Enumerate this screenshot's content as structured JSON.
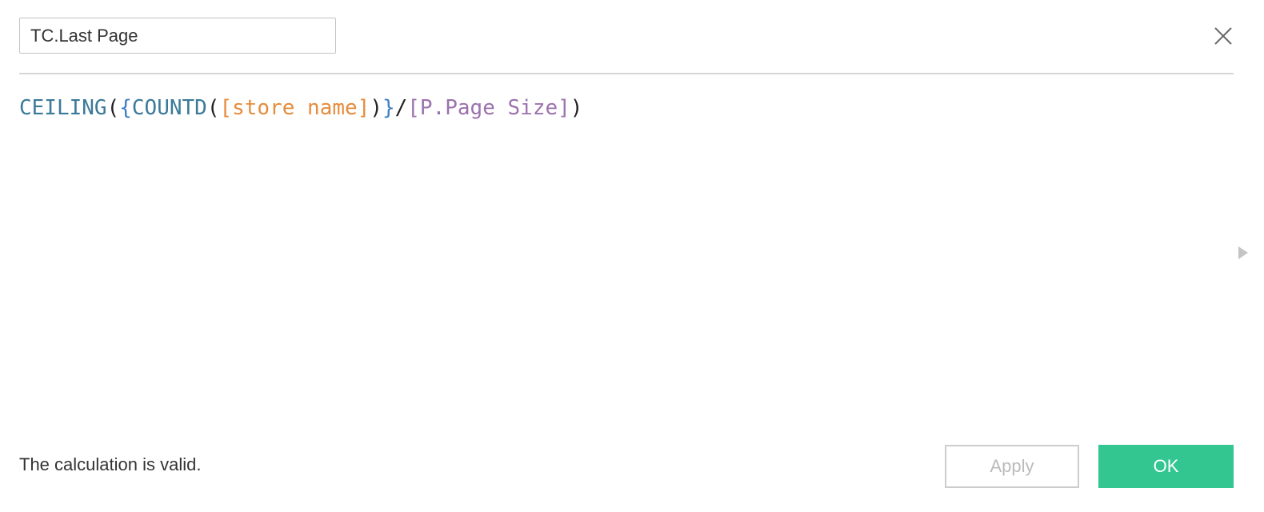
{
  "calc_name": {
    "value": "TC.Last Page"
  },
  "close_icon": "close-icon",
  "formula": {
    "func_ceiling": "CEILING",
    "paren_open_1": "(",
    "brace_open": "{",
    "func_countd": "COUNTD",
    "paren_open_2": "(",
    "field_store_name": "[store name]",
    "paren_close_2": ")",
    "brace_close": "}",
    "divide": "/",
    "param_page_size": "[P.Page Size]",
    "paren_close_1": ")"
  },
  "side_arrow_icon": "caret-right-icon",
  "status": {
    "message": "The calculation is valid."
  },
  "buttons": {
    "apply_label": "Apply",
    "ok_label": "OK"
  },
  "colors": {
    "function": "#3b7a98",
    "brace": "#3f7fc4",
    "field": "#e68c3c",
    "parameter": "#9b72ae",
    "ok_button": "#33c690"
  }
}
